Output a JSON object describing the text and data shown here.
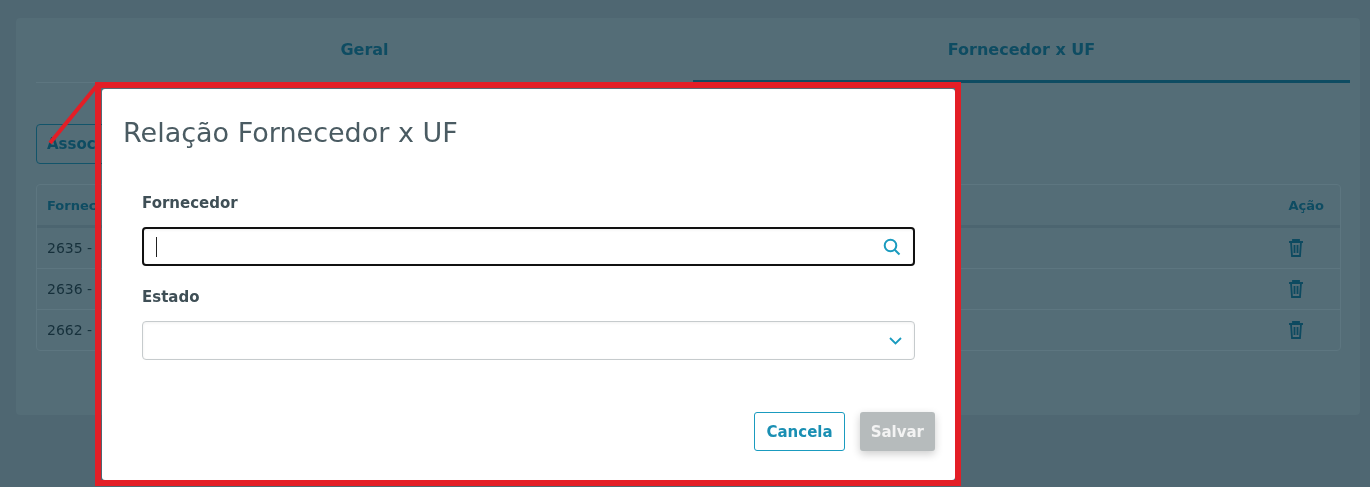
{
  "tabs": [
    {
      "label": "Geral",
      "selected": false
    },
    {
      "label": "Fornecedor x UF",
      "selected": true
    }
  ],
  "associate_button": {
    "label": "Assoc"
  },
  "table": {
    "columns": [
      "Fornec",
      "Ação"
    ],
    "rows": [
      {
        "cells": [
          "2635 -"
        ]
      },
      {
        "cells": [
          "2636 -"
        ]
      },
      {
        "cells": [
          "2662 -"
        ]
      }
    ]
  },
  "dialog": {
    "title": "Relação Fornecedor x UF",
    "fields": [
      {
        "kind": "search",
        "label": "Fornecedor",
        "focused": true
      },
      {
        "kind": "select",
        "label": "Estado",
        "focused": false
      }
    ],
    "buttons": [
      {
        "kind": "outline",
        "label": "Cancela",
        "disabled": false
      },
      {
        "kind": "primary",
        "label": "Salvar",
        "disabled": true
      }
    ]
  }
}
